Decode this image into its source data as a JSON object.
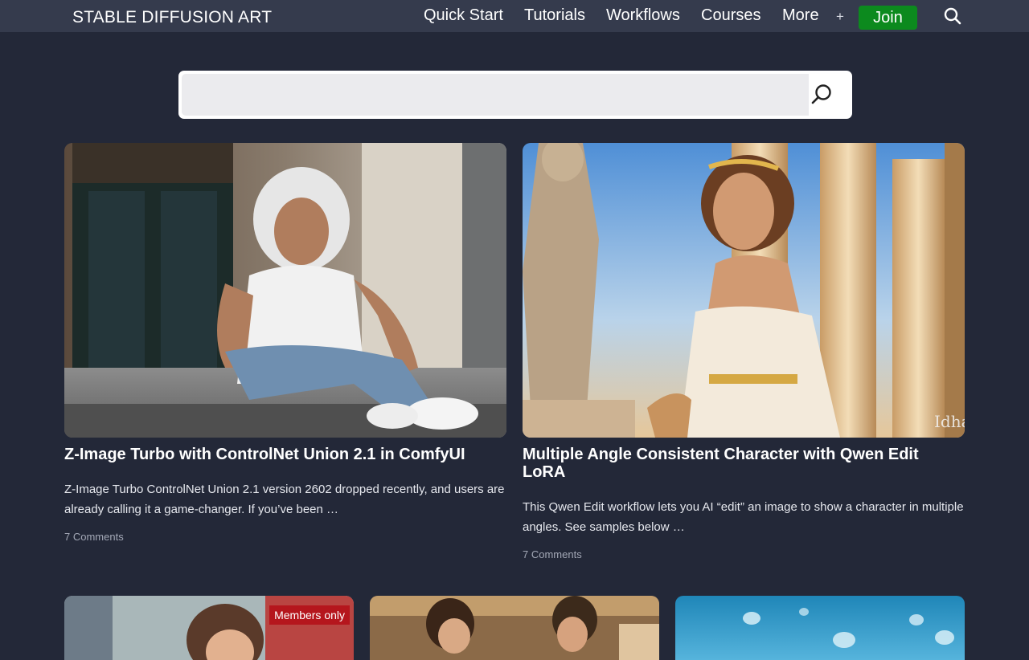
{
  "header": {
    "logo": "STABLE DIFFUSION ART",
    "nav": [
      "Quick Start",
      "Tutorials",
      "Workflows",
      "Courses",
      "More"
    ],
    "plus": "+",
    "join_label": "Join"
  },
  "search": {
    "placeholder": ""
  },
  "posts": [
    {
      "title": "Z-Image Turbo with ControlNet Union 2.1 in ComfyUI",
      "excerpt": "Z-Image Turbo ControlNet Union 2.1 version 2602 dropped recently, and users are already calling it a game-changer. If you’ve been …",
      "comments": "7 Comments"
    },
    {
      "title": "Multiple Angle Consistent Character with Qwen Edit LoRA",
      "excerpt": "This Qwen Edit workflow lets you AI “edit” an image to show a character in multiple angles. See samples below …",
      "comments": "7 Comments"
    }
  ],
  "bottom_cards": [
    {
      "badge": "Members only"
    },
    {
      "badge": ""
    },
    {
      "badge": ""
    }
  ],
  "colors": {
    "page_bg": "#232838",
    "header_bg": "#353b4d",
    "join_green": "#0c8a1e",
    "badge_red": "#b5161d"
  },
  "icons": {
    "header_search": "search-icon",
    "search_button": "search-icon"
  }
}
